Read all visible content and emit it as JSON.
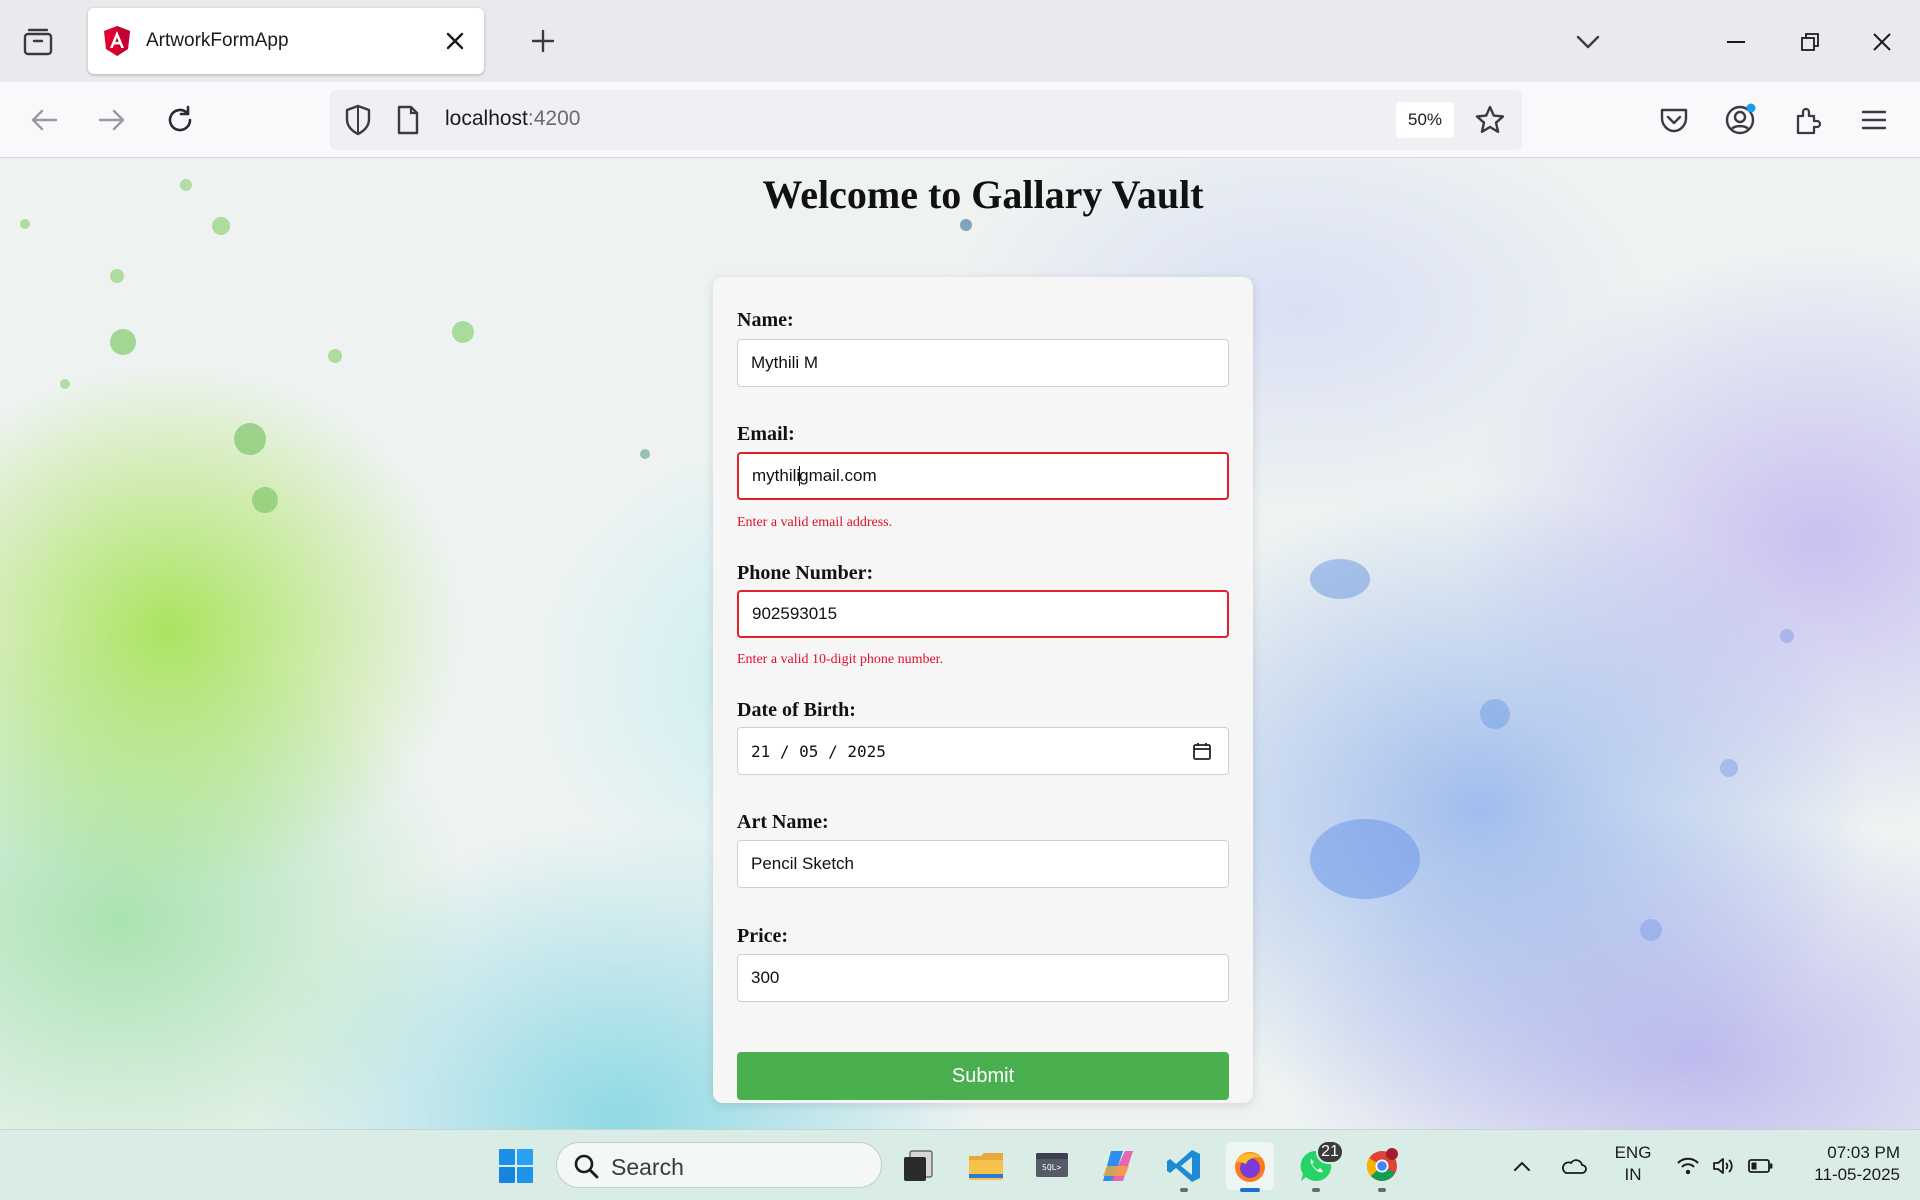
{
  "browser": {
    "tab_title": "ArtworkFormApp",
    "url_host": "localhost",
    "url_port": ":4200",
    "zoom": "50%"
  },
  "page": {
    "title": "Welcome to Gallary Vault"
  },
  "form": {
    "name_label": "Name:",
    "name_value": "Mythili M",
    "email_label": "Email:",
    "email_value_before_caret": "mythili",
    "email_value_after_caret": "gmail.com",
    "email_error": "Enter a valid email address.",
    "phone_label": "Phone Number:",
    "phone_value": "902593015",
    "phone_error": "Enter a valid 10-digit phone number.",
    "dob_label": "Date of Birth:",
    "dob_value": "21 / 05 / 2025",
    "art_label": "Art Name:",
    "art_value": "Pencil Sketch",
    "price_label": "Price:",
    "price_value": "300",
    "submit_label": "Submit"
  },
  "taskbar": {
    "search_label": "Search",
    "whatsapp_badge": "21",
    "lang_line1": "ENG",
    "lang_line2": "IN",
    "time": "07:03 PM",
    "date": "11-05-2025"
  },
  "colors": {
    "error": "#e0102a",
    "submit": "#4aaf4e",
    "angular_brand": "#dd0031"
  }
}
